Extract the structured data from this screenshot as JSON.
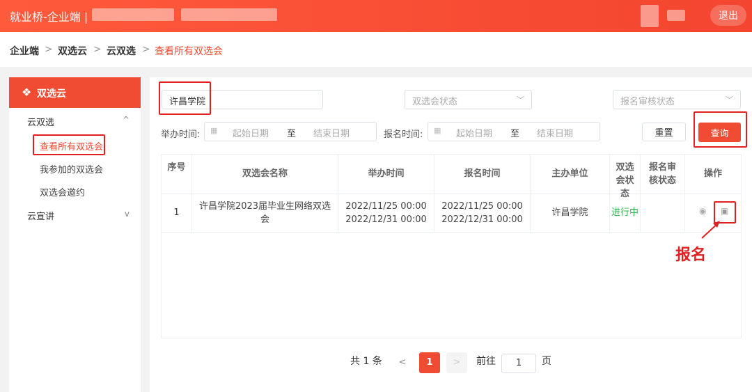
{
  "header": {
    "app_title": "就业桥-企业端 |",
    "logout": "退出"
  },
  "breadcrumb": [
    "企业端",
    "双选云",
    "云双选",
    "查看所有双选会"
  ],
  "breadcrumb_sep": ">",
  "sidebar": {
    "head": "双选云",
    "items": [
      {
        "label": "云双选",
        "chevron": "^"
      },
      {
        "label": "查看所有双选会"
      },
      {
        "label": "我参加的双选会"
      },
      {
        "label": "双选会邀约"
      },
      {
        "label": "云宣讲",
        "chevron": "v"
      }
    ]
  },
  "filters": {
    "school_value": "许昌学院",
    "status_placeholder": "双选会状态",
    "review_placeholder": "报名审核状态",
    "hold_time_label": "举办时间:",
    "reg_time_label": "报名时间:",
    "start_placeholder": "起始日期",
    "end_placeholder": "结束日期",
    "to": "至",
    "reset": "重置",
    "query": "查询"
  },
  "table": {
    "headers": [
      "序号",
      "双选会名称",
      "举办时间",
      "报名时间",
      "主办单位",
      "双选会状态",
      "报名审核状态",
      "操作"
    ],
    "rows": [
      {
        "index": "1",
        "name_line1": "许昌学院2023届毕业生网络双选",
        "name_line2": "会",
        "hold_start": "2022/11/25 00:00",
        "hold_end": "2022/12/31 00:00",
        "reg_start": "2022/11/25 00:00",
        "reg_end": "2022/12/31 00:00",
        "host": "许昌学院",
        "status": "进行中",
        "review": ""
      }
    ]
  },
  "annotation": "报名",
  "pagination": {
    "total": "共 1 条",
    "prev": "<",
    "current": "1",
    "next": ">",
    "goto_label": "前往",
    "goto_value": "1",
    "page_unit": "页"
  },
  "colors": {
    "accent": "#f04b33",
    "status_green": "#2db34a",
    "highlight": "#e02020"
  }
}
